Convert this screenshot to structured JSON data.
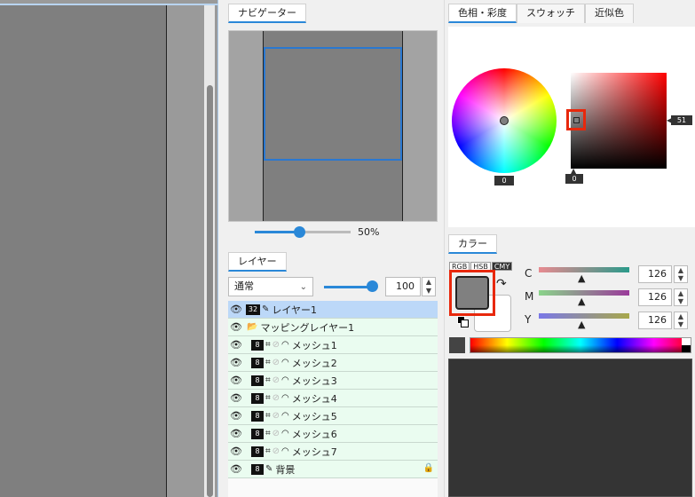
{
  "canvas": {},
  "navigator": {
    "tab_label": "ナビゲーター",
    "zoom_label": "50%",
    "zoom_percent": 50
  },
  "layers": {
    "tab_label": "レイヤー",
    "blend_mode": "通常",
    "opacity": "100",
    "opacity_percent": 100,
    "items": [
      {
        "name": "レイヤー1",
        "bit": "32",
        "type": "raster",
        "selected": true
      },
      {
        "name": "マッピングレイヤー1",
        "type": "folder"
      },
      {
        "name": "メッシュ1",
        "bit": "8",
        "type": "mesh"
      },
      {
        "name": "メッシュ2",
        "bit": "8",
        "type": "mesh"
      },
      {
        "name": "メッシュ3",
        "bit": "8",
        "type": "mesh"
      },
      {
        "name": "メッシュ4",
        "bit": "8",
        "type": "mesh"
      },
      {
        "name": "メッシュ5",
        "bit": "8",
        "type": "mesh"
      },
      {
        "name": "メッシュ6",
        "bit": "8",
        "type": "mesh"
      },
      {
        "name": "メッシュ7",
        "bit": "8",
        "type": "mesh"
      },
      {
        "name": "背景",
        "bit": "8",
        "type": "raster",
        "locked": true
      }
    ]
  },
  "color_wheel": {
    "tabs": [
      "色相・彩度",
      "スウォッチ",
      "近似色"
    ],
    "active_tab": "色相・彩度",
    "hue_value": "0",
    "saturation_value": "0",
    "value_value": "51"
  },
  "color_set": {
    "tab_label": "カラー",
    "modes": [
      "RGB",
      "HSB",
      "CMY"
    ],
    "active_mode": "CMY",
    "main_color": "#808080",
    "sub_color": "#ffffff",
    "channels": [
      {
        "label": "C",
        "value": "126"
      },
      {
        "label": "M",
        "value": "126"
      },
      {
        "label": "Y",
        "value": "126"
      }
    ]
  },
  "colors": {
    "accent": "#2a88d8",
    "highlight": "#e8280c"
  }
}
